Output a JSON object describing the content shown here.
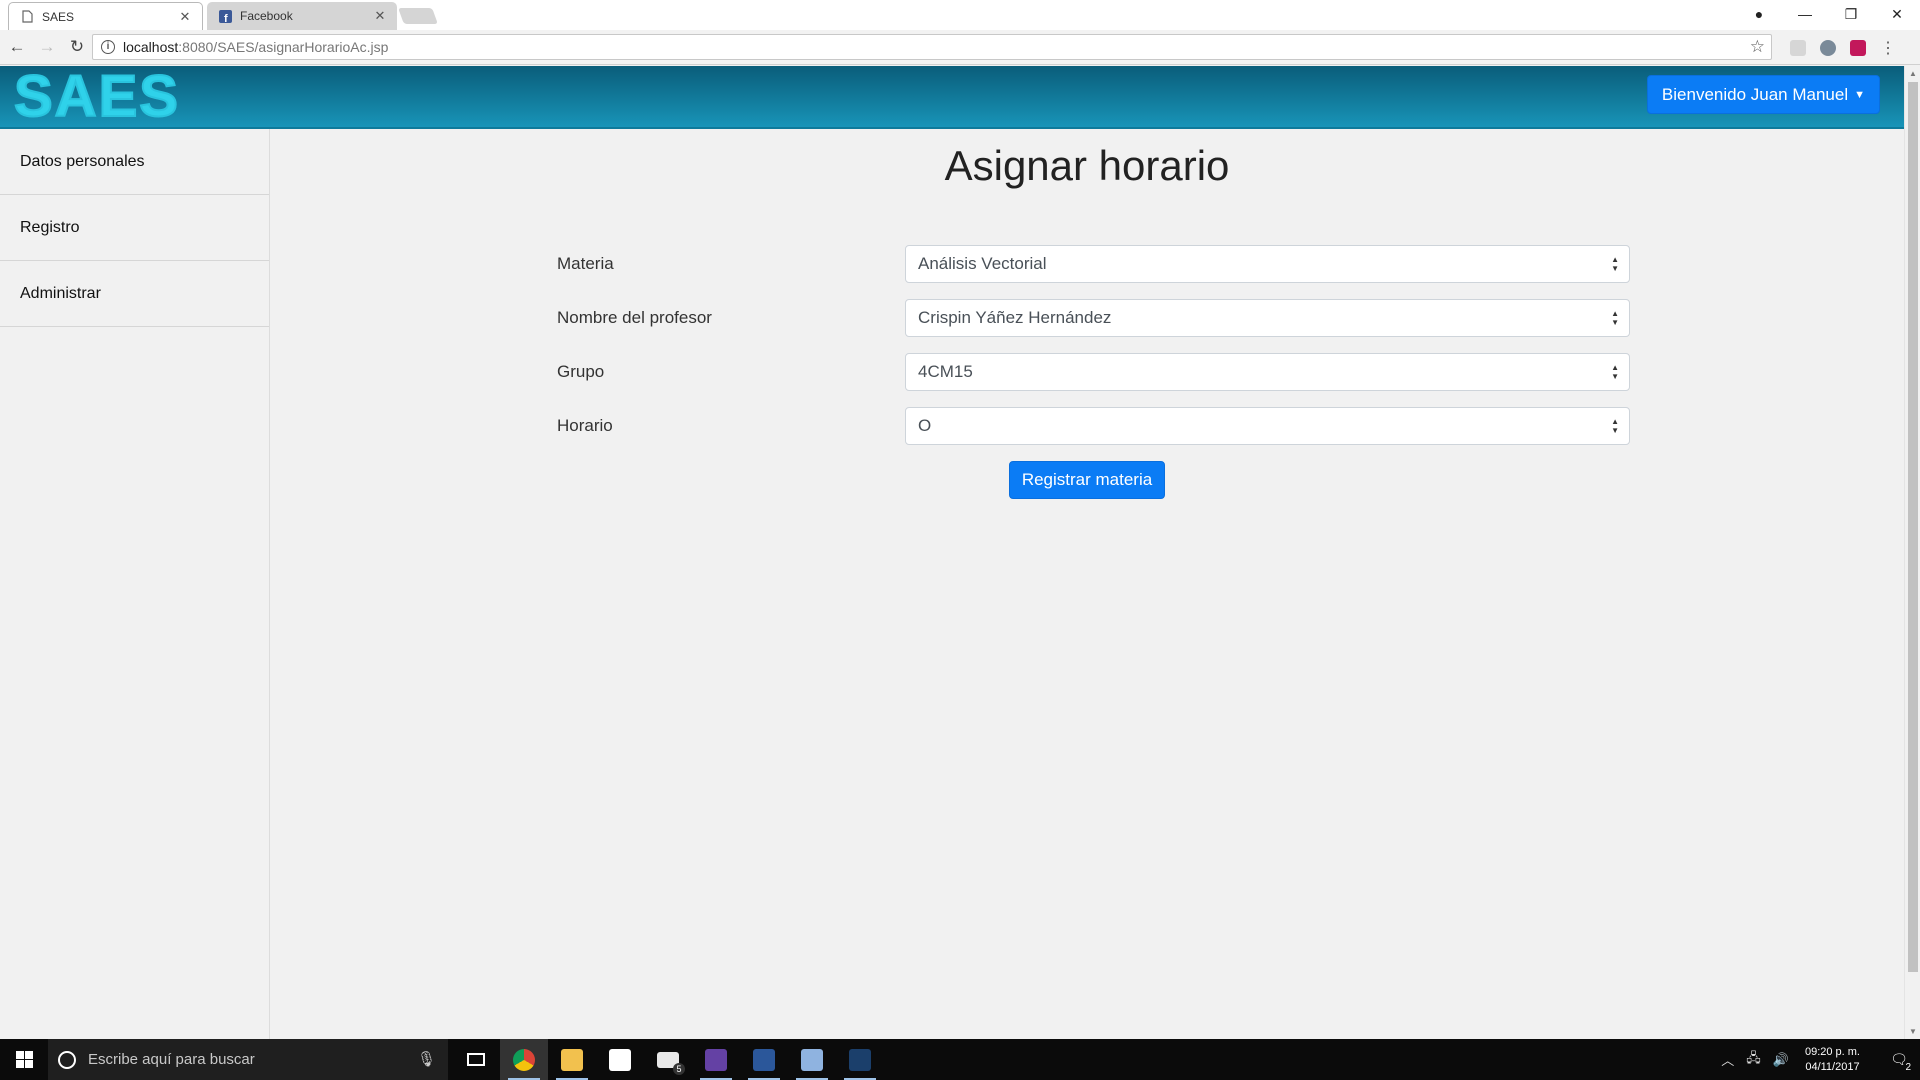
{
  "browser": {
    "tabs": [
      {
        "title": "SAES",
        "active": true
      },
      {
        "title": "Facebook",
        "active": false
      }
    ],
    "url_host": "localhost",
    "url_path": ":8080/SAES/asignarHorarioAc.jsp"
  },
  "header": {
    "logo_text": "SAES",
    "welcome_label": "Bienvenido Juan Manuel"
  },
  "sidebar": {
    "items": [
      {
        "label": "Datos personales"
      },
      {
        "label": "Registro"
      },
      {
        "label": "Administrar"
      }
    ]
  },
  "main": {
    "title": "Asignar horario",
    "fields": [
      {
        "label": "Materia",
        "value": "Análisis Vectorial"
      },
      {
        "label": "Nombre del profesor",
        "value": "Crispin Yáñez Hernández"
      },
      {
        "label": "Grupo",
        "value": "4CM15"
      },
      {
        "label": "Horario",
        "value": "O"
      }
    ],
    "submit_label": "Registrar materia"
  },
  "taskbar": {
    "search_placeholder": "Escribe aquí para buscar",
    "apps": [
      {
        "icon": "task-view-icon"
      },
      {
        "icon": "chrome-icon"
      },
      {
        "icon": "file-explorer-icon"
      },
      {
        "icon": "store-icon"
      },
      {
        "icon": "mail-icon",
        "badge": "5"
      },
      {
        "icon": "twitch-icon"
      },
      {
        "icon": "word-icon"
      },
      {
        "icon": "virtualbox-icon"
      },
      {
        "icon": "netbeans-icon"
      }
    ],
    "time": "09:20 p. m.",
    "date": "04/11/2017",
    "notification_count": "2"
  },
  "colors": {
    "header_gradient_top": "#0a5d7a",
    "header_gradient_bottom": "#1894b8",
    "primary_button": "#0b7cf5",
    "logo": "#2fd2ea",
    "page_background": "#f1f1f1"
  }
}
